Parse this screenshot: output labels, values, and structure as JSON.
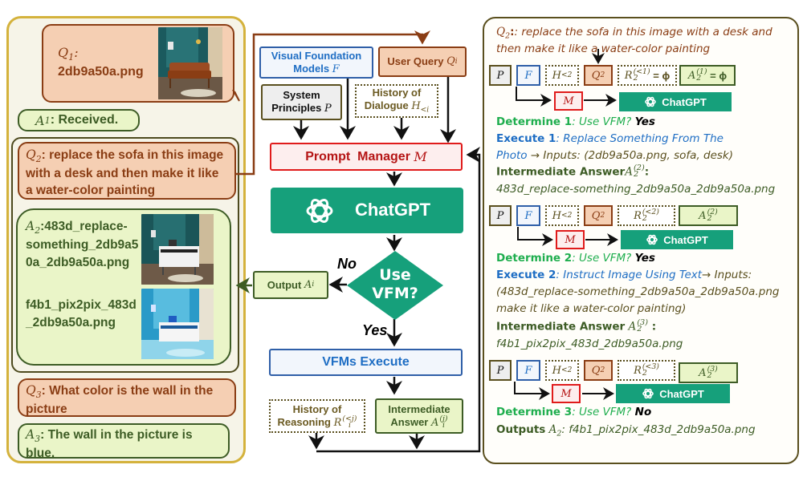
{
  "left_panel": {
    "q1": {
      "label": "Q",
      "sub": "1",
      "text": "2db9a50a.png",
      "image": "living-room-with-leather-sofa"
    },
    "a1": {
      "label": "A",
      "sub": "1",
      "text": ": Received."
    },
    "q2": {
      "label": "Q",
      "sub": "2",
      "text": ": replace the sofa in this image with a desk and then make it like a water-color painting"
    },
    "a2": {
      "label": "A",
      "sub": "2",
      "file1": ":483d_replace-something_2db9a50a_2db9a50a.png",
      "file1_lines": [
        ":483d_replace-",
        "something_2db9a5",
        "0a_2db9a50a.png"
      ],
      "file2_lines": [
        "f4b1_pix2pix_483d",
        "_2db9a50a.png"
      ],
      "image1": "room-with-white-desk",
      "image2": "watercolor-room-with-white-desk"
    },
    "q3": {
      "label": "Q",
      "sub": "3",
      "text": ": What color is the wall in the picture"
    },
    "a3": {
      "label": "A",
      "sub": "3",
      "text": ": The wall in the picture is blue."
    }
  },
  "center": {
    "vfm": {
      "line1": "Visual Foundation",
      "line2": "Models",
      "sym": "F"
    },
    "user_query": {
      "text": "User Query",
      "sym": "Q",
      "sub": "i"
    },
    "system_principles": {
      "line1": "System",
      "line2": "Principles",
      "sym": "P"
    },
    "history_dialogue": {
      "line1": "History of",
      "line2": "Dialogue",
      "sym": "H",
      "sub": "<i"
    },
    "prompt_manager": {
      "text": "Prompt  Manager",
      "sym": "M"
    },
    "chatgpt": {
      "text": "ChatGPT"
    },
    "decision": {
      "line1": "Use",
      "line2": "VFM?",
      "no_label": "No",
      "yes_label": "Yes"
    },
    "output": {
      "text": "Output",
      "sym": "A",
      "sub": "i"
    },
    "vfms_execute": {
      "text": "VFMs Execute"
    },
    "history_reasoning": {
      "line1": "History of",
      "line2": "Reasoning",
      "sym": "R",
      "sub": "i",
      "sup": "(<j)"
    },
    "intermediate_answer": {
      "line1": "Intermediate",
      "line2": "Answer",
      "sym": "A",
      "sub": "i",
      "sup": "(j)"
    }
  },
  "right_panel": {
    "q2_line1": ": replace the sofa in this image with a desk and",
    "q2_line2": "then make it like a water-color painting",
    "q2_label": "Q",
    "q2_sub": "2",
    "token_rows": [
      {
        "p": "P",
        "f": "F",
        "h": "H",
        "h_sub": "<2",
        "q": "Q",
        "q_sub": "2",
        "r_sup": "(<1)",
        "r_sub": "2",
        "r_suffix": "= ϕ",
        "a_sup": "(1)",
        "a_sub": "2",
        "a_suffix": "= ϕ"
      },
      {
        "p": "P",
        "f": "F",
        "h": "H",
        "h_sub": "<2",
        "q": "Q",
        "q_sub": "2",
        "r_sup": "(<2)",
        "r_sub": "2",
        "r_suffix": "",
        "a_sup": "(2)",
        "a_sub": "2",
        "a_suffix": ""
      },
      {
        "p": "P",
        "f": "F",
        "h": "H",
        "h_sub": "<2",
        "q": "Q",
        "q_sub": "2",
        "r_sup": "(<3)",
        "r_sub": "2",
        "r_suffix": "",
        "a_sup": "(3)",
        "a_sub": "2",
        "a_suffix": ""
      }
    ],
    "m_sym": "M",
    "chatgpt_label": "ChatGPT",
    "determine1": {
      "label": "Determine 1",
      "q": ": Use VFM?",
      "ans": "Yes"
    },
    "execute1": {
      "label": "Execute 1",
      "tool_a": ": Replace Something From The",
      "tool_b": "Photo",
      "arrow": "→",
      "inputs": "Inputs: (2db9a50a.png, sofa, desk)"
    },
    "inter1": {
      "label": "Intermediate Answer",
      "sym": "A",
      "sup": "(2)",
      "sub": "2",
      "colon": ":",
      "value": "483d_replace-something_2db9a50a_2db9a50a.png"
    },
    "determine2": {
      "label": "Determine 2",
      "q": ": Use VFM?",
      "ans": "Yes"
    },
    "execute2": {
      "label": "Execute 2",
      "tool": ": Instruct Image Using Text",
      "arrow": "→",
      "inputs": "Inputs:",
      "inputs_line2": "(483d_replace-something_2db9a50a_2db9a50a.png",
      "inputs_line3": "make it like a water-color painting)"
    },
    "inter2": {
      "label": "Intermediate Answer",
      "sym": "A",
      "sup": "(3)",
      "sub": "2",
      "colon": " :",
      "value": "f4b1_pix2pix_483d_2db9a50a.png"
    },
    "determine3": {
      "label": "Determine 3",
      "q": ": Use VFM?",
      "ans": "No"
    },
    "outputs": {
      "label": "Outputs",
      "sym": "A",
      "sub": "2",
      "value": ": f4b1_pix2pix_483d_2db9a50a.png"
    }
  },
  "colors": {
    "query_fill": "#f5cfb3",
    "query_border": "#8a3d14",
    "answer_fill": "#eaf5c8",
    "answer_border": "#3d5c25",
    "vfm_blue": "#1f6ec4",
    "prompt_red": "#e01b1b",
    "chatgpt_green": "#16a07b",
    "panel_gold": "#d4b23c"
  }
}
